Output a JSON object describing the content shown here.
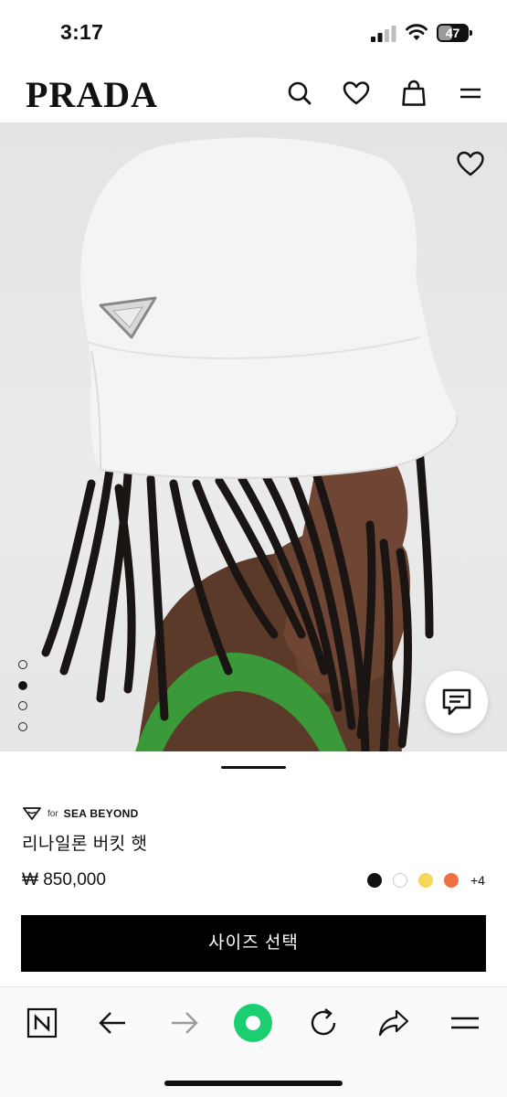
{
  "status_bar": {
    "time": "3:17",
    "battery_level": "47",
    "battery_fraction": 0.47
  },
  "header": {
    "logo_text": "PRADA",
    "icons": [
      "search-icon",
      "heart-icon",
      "shopping-bag-icon",
      "menu-icon"
    ]
  },
  "hero": {
    "image_count": 4,
    "active_image_index": 1,
    "icons": [
      "heart-icon",
      "chat-icon"
    ]
  },
  "product": {
    "badge_prefix": "for",
    "badge_label": "SEA BEYOND",
    "name": "리나일론 버킷 햇",
    "price": "₩ 850,000",
    "colors": [
      "#111111",
      "#ffffff",
      "#f5d75a",
      "#f07044"
    ],
    "more_colors": "+4",
    "cta_label": "사이즈 선택"
  },
  "browser_bar": {
    "icons": [
      "naver-n-icon",
      "back-arrow-icon",
      "forward-arrow-icon",
      "home-green-icon",
      "refresh-icon",
      "share-icon",
      "menu-icon"
    ]
  }
}
